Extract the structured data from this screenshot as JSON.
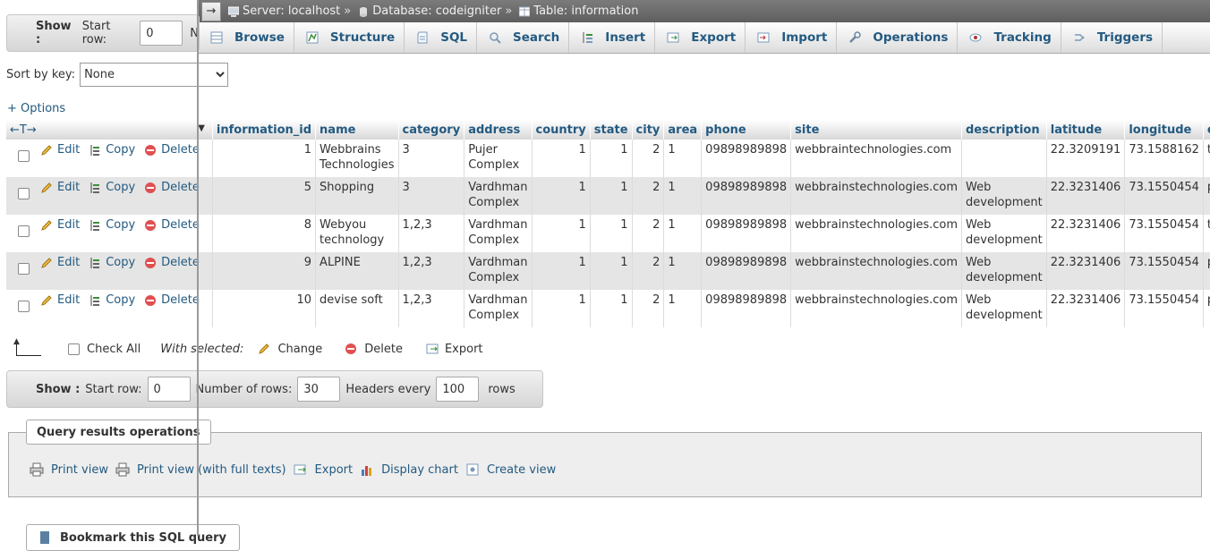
{
  "breadcrumb": {
    "server": "Server: localhost",
    "database": "Database: codeigniter",
    "table": "Table: information",
    "sep": "»"
  },
  "tabs": [
    {
      "label": "Browse",
      "icon": "browse-icon"
    },
    {
      "label": "Structure",
      "icon": "structure-icon"
    },
    {
      "label": "SQL",
      "icon": "sql-icon"
    },
    {
      "label": "Search",
      "icon": "search-icon"
    },
    {
      "label": "Insert",
      "icon": "insert-icon"
    },
    {
      "label": "Export",
      "icon": "export-icon"
    },
    {
      "label": "Import",
      "icon": "import-icon"
    },
    {
      "label": "Operations",
      "icon": "wrench-icon"
    },
    {
      "label": "Tracking",
      "icon": "eye-icon"
    },
    {
      "label": "Triggers",
      "icon": "triggers-icon"
    }
  ],
  "show_top": {
    "show_label": "Show :",
    "start_row_label": "Start row:",
    "start_row_value": "0",
    "trailing": "N"
  },
  "sort": {
    "label": "Sort by key:",
    "selected": "None"
  },
  "options_link": "+ Options",
  "table": {
    "sort_arrows": "←T→",
    "columns": [
      "information_id",
      "name",
      "category",
      "address",
      "country",
      "state",
      "city",
      "area",
      "phone",
      "site",
      "description",
      "latitude",
      "longitude",
      "ema"
    ],
    "action_labels": {
      "edit": "Edit",
      "copy": "Copy",
      "delete": "Delete"
    },
    "rows": [
      {
        "information_id": "1",
        "name": "Webbrains Technologies",
        "category": "3",
        "address": "Pujer Complex",
        "country": "1",
        "state": "1",
        "city": "2",
        "area": "1",
        "phone": "09898989898",
        "site": "webbraintechnologies.com",
        "description": "",
        "latitude": "22.3209191",
        "longitude": "73.1588162",
        "ema": "test"
      },
      {
        "information_id": "5",
        "name": "Shopping",
        "category": "3",
        "address": "Vardhman Complex",
        "country": "1",
        "state": "1",
        "city": "2",
        "area": "1",
        "phone": "09898989898",
        "site": "webbrainstechnologies.com",
        "description": "Web development",
        "latitude": "22.3231406",
        "longitude": "73.1550454",
        "ema": "priy"
      },
      {
        "information_id": "8",
        "name": "Webyou technology",
        "category": "1,2,3",
        "address": "Vardhman Complex",
        "country": "1",
        "state": "1",
        "city": "2",
        "area": "1",
        "phone": "09898989898",
        "site": "webbrainstechnologies.com",
        "description": "Web development",
        "latitude": "22.3231406",
        "longitude": "73.1550454",
        "ema": "test"
      },
      {
        "information_id": "9",
        "name": "ALPINE",
        "category": "1,2,3",
        "address": "Vardhman Complex",
        "country": "1",
        "state": "1",
        "city": "2",
        "area": "1",
        "phone": "09898989898",
        "site": "webbrainstechnologies.com",
        "description": "Web development",
        "latitude": "22.3231406",
        "longitude": "73.1550454",
        "ema": "priy"
      },
      {
        "information_id": "10",
        "name": "devise soft",
        "category": "1,2,3",
        "address": "Vardhman Complex",
        "country": "1",
        "state": "1",
        "city": "2",
        "area": "1",
        "phone": "09898989898",
        "site": "webbrainstechnologies.com",
        "description": "Web development",
        "latitude": "22.3231406",
        "longitude": "73.1550454",
        "ema": "priy"
      }
    ]
  },
  "with_selected": {
    "check_all": "Check All",
    "label": "With selected:",
    "change": "Change",
    "delete": "Delete",
    "export": "Export"
  },
  "show_bottom": {
    "show_label": "Show :",
    "start_row_label": "Start row:",
    "start_row_value": "0",
    "num_rows_label": "Number of rows:",
    "num_rows_value": "30",
    "headers_label": "Headers every",
    "headers_value": "100",
    "rows_label": "rows"
  },
  "query_ops": {
    "legend": "Query results operations",
    "links": [
      "Print view",
      "Print view (with full texts)",
      "Export",
      "Display chart",
      "Create view"
    ]
  },
  "bookmark": {
    "legend": "Bookmark this SQL query"
  },
  "colors": {
    "link": "#235a81",
    "even_row": "#e5e5e5",
    "topbar": "#6a6a6a"
  }
}
